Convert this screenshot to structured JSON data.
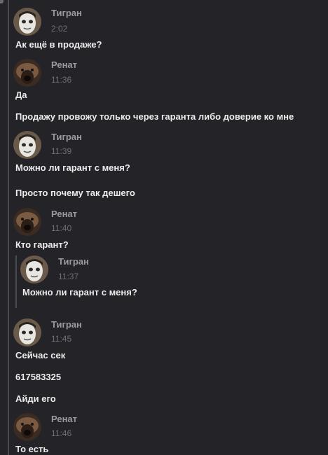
{
  "messages": [
    {
      "author": "Тигран",
      "time": "2:02",
      "avatar": "white-face-avatar",
      "texts": [
        "Ак ещё в продаже?"
      ]
    },
    {
      "author": "Ренат",
      "time": "11:36",
      "avatar": "dark-dog-avatar",
      "texts": [
        "Да",
        "Продажу провожу только через гаранта либо доверие ко мне"
      ]
    },
    {
      "author": "Тигран",
      "time": "11:39",
      "avatar": "white-face-avatar",
      "texts": [
        "Можно ли гарант с меня?",
        "Просто почему так дешего"
      ]
    },
    {
      "author": "Ренат",
      "time": "11:40",
      "avatar": "dark-dog-avatar",
      "texts": [
        "Кто гарант?"
      ]
    },
    {
      "author": "Тигран",
      "time": "11:45",
      "avatar": "white-face-avatar",
      "texts": [
        "Сейчас сек",
        "617583325",
        "Айди его"
      ]
    },
    {
      "author": "Ренат",
      "time": "11:46",
      "avatar": "dark-dog-avatar",
      "texts": [
        "То есть"
      ]
    }
  ],
  "quote": {
    "author": "Тигран",
    "time": "11:37",
    "avatar": "white-face-avatar",
    "text": "Можно ли гарант с меня?"
  },
  "colors": {
    "background": "#232328",
    "text": "#ececec",
    "name": "#9a9aa0",
    "time": "#6f6f75",
    "thread_line": "#4a4a52"
  }
}
